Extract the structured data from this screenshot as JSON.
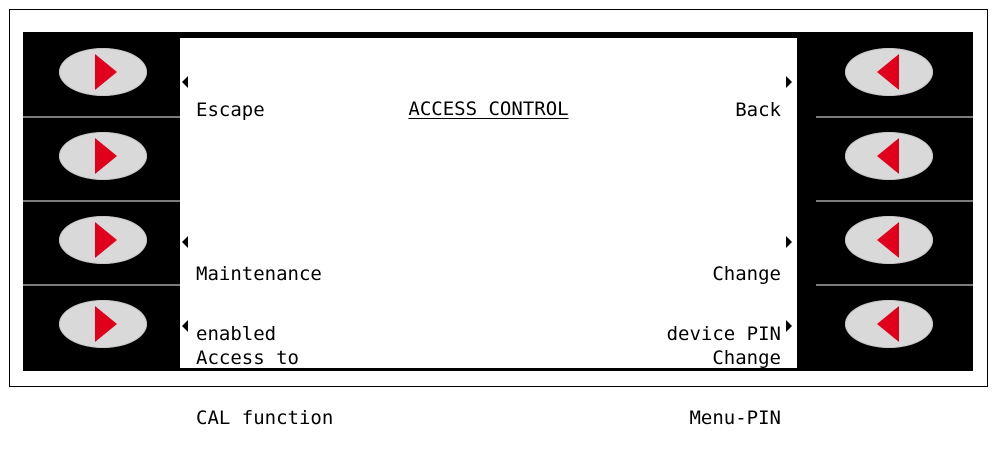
{
  "screen": {
    "title": "ACCESS CONTROL",
    "left_labels": [
      {
        "line1": "Escape",
        "line2": ""
      },
      {
        "line1": "",
        "line2": ""
      },
      {
        "line1": "Maintenance",
        "line2": "enabled"
      },
      {
        "line1": "Access to",
        "line2": "CAL function"
      }
    ],
    "right_labels": [
      {
        "line1": "Back",
        "line2": ""
      },
      {
        "line1": "",
        "line2": ""
      },
      {
        "line1": "Change",
        "line2": "device PIN"
      },
      {
        "line1": "Change",
        "line2": "Menu-PIN"
      }
    ]
  },
  "keys": {
    "left_arrow_color": "#e0001b",
    "right_arrow_color": "#e0001b",
    "key_color": "#d9d9d9"
  },
  "icons": {
    "left_key_icon": "arrow-right-icon",
    "right_key_icon": "arrow-left-icon"
  }
}
